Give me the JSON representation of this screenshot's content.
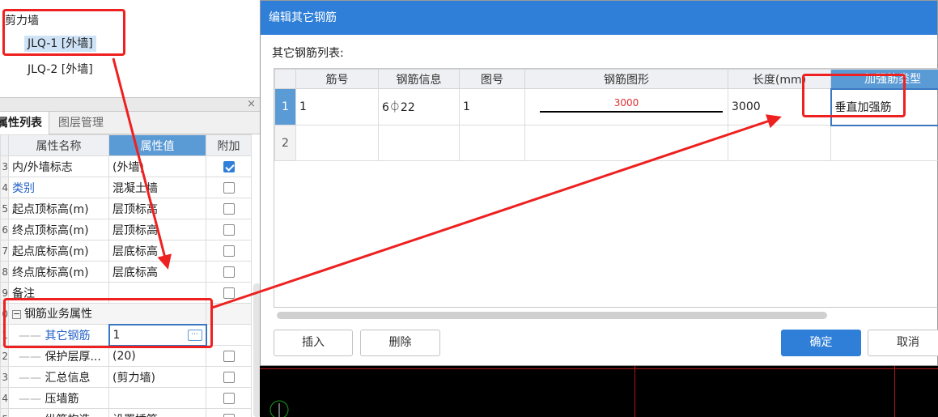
{
  "tree": {
    "root": "剪力墙",
    "items": [
      "JLQ-1 [外墙]",
      "JLQ-2 [外墙]"
    ]
  },
  "left_panel": {
    "close": "×",
    "tabs": [
      "属性列表",
      "图层管理"
    ],
    "columns": [
      "属性名称",
      "属性值",
      "附加"
    ],
    "rows": [
      {
        "idx": "3",
        "name": "内/外墙标志",
        "value": "(外墙)",
        "checked": true
      },
      {
        "idx": "4",
        "name": "类别",
        "value": "混凝土墙",
        "checked": false
      },
      {
        "idx": "5",
        "name": "起点顶标高(m)",
        "value": "层顶标高",
        "checked": false
      },
      {
        "idx": "6",
        "name": "终点顶标高(m)",
        "value": "层顶标高",
        "checked": false
      },
      {
        "idx": "7",
        "name": "起点底标高(m)",
        "value": "层底标高",
        "checked": false
      },
      {
        "idx": "8",
        "name": "终点底标高(m)",
        "value": "层底标高",
        "checked": false
      },
      {
        "idx": "9",
        "name": "备注",
        "value": "",
        "checked": false
      },
      {
        "idx": "0",
        "name": "钢筋业务属性",
        "value": "",
        "group": true
      },
      {
        "idx": "1",
        "name": "其它钢筋",
        "value": "1",
        "checked": null,
        "edit": true
      },
      {
        "idx": "2",
        "name": "保护层厚...",
        "value": "(20)",
        "checked": false
      },
      {
        "idx": "3",
        "name": "汇总信息",
        "value": "(剪力墙)",
        "checked": false
      },
      {
        "idx": "4",
        "name": "压墙筋",
        "value": "",
        "checked": false
      },
      {
        "idx": "5",
        "name": "纵筋构造",
        "value": "设置插筋",
        "checked": false
      }
    ],
    "ellipsis": "···"
  },
  "dialog": {
    "title": "编辑其它钢筋",
    "subtitle": "其它钢筋列表:",
    "columns": [
      "筋号",
      "钢筋信息",
      "图号",
      "钢筋图形",
      "长度(mm)",
      "加强筋类型"
    ],
    "rows": [
      {
        "rn": "1",
        "jinhao": "1",
        "info": "6⏀22",
        "tuhao": "1",
        "shape_value": "3000",
        "length": "3000",
        "type": "垂直加强筋"
      },
      {
        "rn": "2",
        "jinhao": "",
        "info": "",
        "tuhao": "",
        "shape_value": "",
        "length": "",
        "type": ""
      }
    ],
    "buttons": {
      "insert": "插入",
      "delete": "删除",
      "ok": "确定",
      "cancel": "取消"
    }
  },
  "colors": {
    "accent": "#2f7fd8",
    "annotation": "#ee2020"
  }
}
